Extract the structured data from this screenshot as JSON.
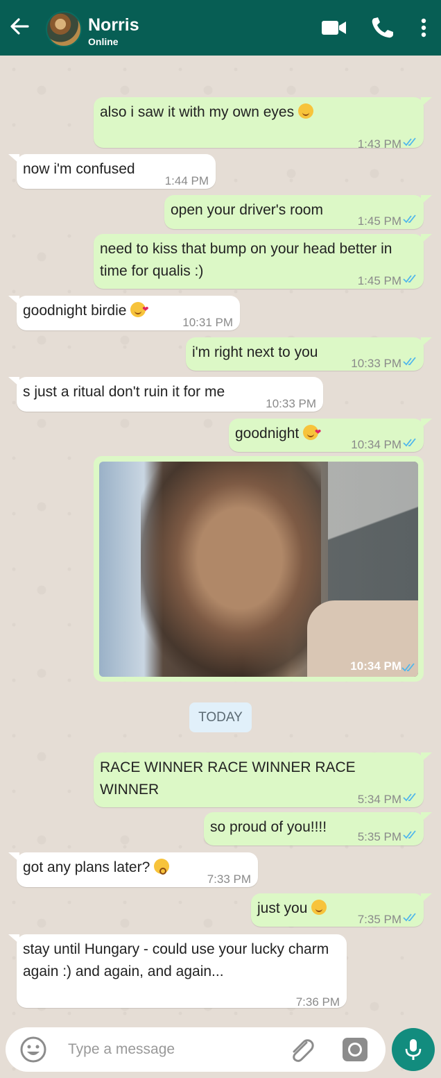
{
  "header": {
    "contact_name": "Norris",
    "status": "Online",
    "icons": [
      "back-arrow-icon",
      "video-call-icon",
      "phone-call-icon",
      "more-options-icon"
    ]
  },
  "messages": [
    {
      "dir": "out",
      "text": "also i saw it with my own eyes",
      "emoji": "smiling-face",
      "time": "1:43 PM",
      "read": true
    },
    {
      "dir": "in",
      "text": "now i'm confused",
      "time": "1:44 PM"
    },
    {
      "dir": "out",
      "text": "open your driver's room",
      "time": "1:45 PM",
      "read": true
    },
    {
      "dir": "out",
      "text": "need to kiss that bump on your head better in time for qualis :)",
      "time": "1:45 PM",
      "read": true
    },
    {
      "dir": "in",
      "text": "goodnight birdie",
      "emoji": "kiss-face",
      "time": "10:31 PM"
    },
    {
      "dir": "out",
      "text": "i'm right next to you",
      "time": "10:33 PM",
      "read": true
    },
    {
      "dir": "in",
      "text": "s just a ritual don't ruin it for me",
      "time": "10:33 PM"
    },
    {
      "dir": "out",
      "text": "goodnight",
      "emoji": "kiss-face",
      "time": "10:34 PM",
      "read": true
    },
    {
      "dir": "out",
      "type": "photo",
      "time": "10:34 PM",
      "read": true
    },
    {
      "dir": "out",
      "text": "RACE WINNER RACE WINNER RACE WINNER",
      "time": "5:34 PM",
      "read": true
    },
    {
      "dir": "out",
      "text": "so proud of you!!!!",
      "time": "5:35 PM",
      "read": true
    },
    {
      "dir": "in",
      "text": "got any plans later?",
      "emoji": "dizzy-face",
      "time": "7:33 PM"
    },
    {
      "dir": "out",
      "text": "just you",
      "emoji": "smiling-face",
      "time": "7:35 PM",
      "read": true
    },
    {
      "dir": "in",
      "text": "stay until Hungary - could use your lucky charm again :) and again, and again...",
      "time": "7:36 PM"
    }
  ],
  "date_separator": "TODAY",
  "composer": {
    "placeholder": "Type a message",
    "icons": [
      "emoji-icon",
      "attachment-icon",
      "camera-icon",
      "microphone-icon"
    ]
  },
  "colors": {
    "header": "#075e54",
    "outgoing_bubble": "#dcf8c6",
    "incoming_bubble": "#ffffff",
    "read_tick": "#4fb6ec",
    "mic_button": "#128c7e"
  }
}
